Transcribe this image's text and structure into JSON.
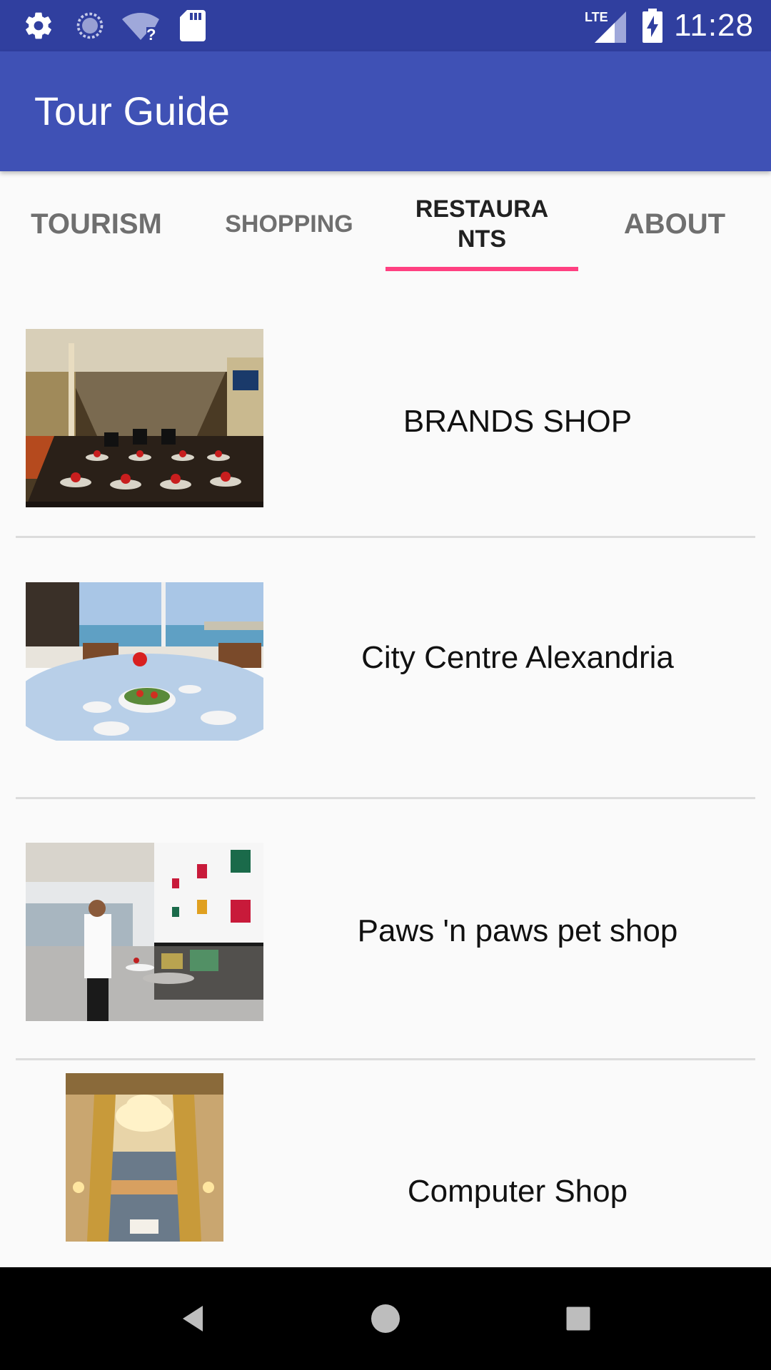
{
  "status_bar": {
    "time": "11:28",
    "network": "LTE",
    "icons": [
      "gear-icon",
      "sync-icon",
      "wifi-unknown-icon",
      "sd-card-icon",
      "lte-signal-icon",
      "battery-charging-icon"
    ]
  },
  "app_bar": {
    "title": "Tour Guide",
    "color": "#3f51b5"
  },
  "tabs": [
    {
      "label": "TOURISM",
      "selected": false
    },
    {
      "label": "SHOPPING",
      "selected": false
    },
    {
      "label": "RESTAURANTS",
      "selected": true
    },
    {
      "label": "ABOUT",
      "selected": false
    }
  ],
  "accent_color": "#ff4081",
  "items": [
    {
      "title": "BRANDS SHOP",
      "image": "restaurant-dining-hall-photo"
    },
    {
      "title": "City Centre Alexandria",
      "image": "seaside-table-photo"
    },
    {
      "title": "Paws 'n paws pet shop",
      "image": "cafe-interior-photo"
    },
    {
      "title": "Computer Shop",
      "image": "chandelier-hall-photo"
    }
  ],
  "nav_bar": {
    "icons": [
      "back-icon",
      "home-icon",
      "recents-icon"
    ]
  }
}
